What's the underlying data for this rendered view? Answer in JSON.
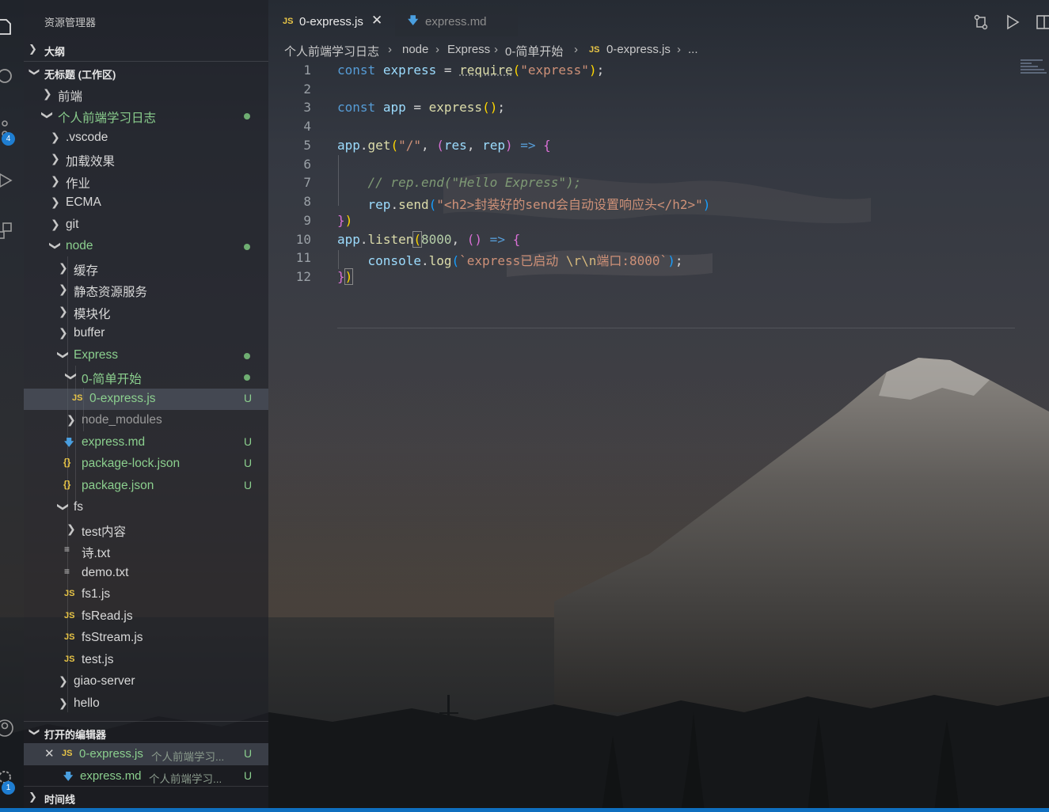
{
  "sidebar": {
    "title": "资源管理器",
    "outline_label": "大纲",
    "workspace_label": "无标题 (工作区)",
    "tree": [
      {
        "label": "前端"
      },
      {
        "label": "个人前端学习日志"
      },
      {
        "label": ".vscode"
      },
      {
        "label": "加载效果"
      },
      {
        "label": "作业"
      },
      {
        "label": "ECMA"
      },
      {
        "label": "git"
      },
      {
        "label": "node"
      },
      {
        "label": "缓存"
      },
      {
        "label": "静态资源服务"
      },
      {
        "label": "模块化"
      },
      {
        "label": "buffer"
      },
      {
        "label": "Express"
      },
      {
        "label": "0-简单开始"
      },
      {
        "label": "0-express.js",
        "status": "U"
      },
      {
        "label": "node_modules"
      },
      {
        "label": "express.md",
        "status": "U"
      },
      {
        "label": "package-lock.json",
        "status": "U"
      },
      {
        "label": "package.json",
        "status": "U"
      },
      {
        "label": "fs"
      },
      {
        "label": "test内容"
      },
      {
        "label": "诗.txt"
      },
      {
        "label": "demo.txt"
      },
      {
        "label": "fs1.js"
      },
      {
        "label": "fsRead.js"
      },
      {
        "label": "fsStream.js"
      },
      {
        "label": "test.js"
      },
      {
        "label": "giao-server"
      },
      {
        "label": "hello"
      }
    ],
    "open_editors_label": "打开的编辑器",
    "open_editors": [
      {
        "name": "0-express.js",
        "path": "个人前端学习...",
        "status": "U"
      },
      {
        "name": "express.md",
        "path": "个人前端学习...",
        "status": "U"
      }
    ],
    "timeline_label": "时间线"
  },
  "activity": {
    "source_control_badge": "4",
    "settings_badge": "1"
  },
  "tabs": [
    {
      "label": "0-express.js",
      "icon": "JS",
      "active": true
    },
    {
      "label": "express.md",
      "icon": "markdown-icon",
      "active": false
    }
  ],
  "breadcrumb": [
    "个人前端学习日志",
    "node",
    "Express",
    "0-简单开始",
    "0-express.js",
    "..."
  ],
  "breadcrumb_icon": "JS",
  "file_icons": {
    "js": "JS",
    "json": "{}"
  },
  "code": {
    "line_numbers": [
      "1",
      "2",
      "3",
      "4",
      "5",
      "6",
      "7",
      "8",
      "9",
      "10",
      "11",
      "12"
    ],
    "l1": {
      "kw": "const",
      "name": "express",
      "op": " = ",
      "fn": "require",
      "open": "(",
      "str": "\"express\"",
      "close": ")",
      "end": ";"
    },
    "l3": {
      "kw": "const",
      "name": "app",
      "op": " = ",
      "fn": "express",
      "parens": "()",
      "end": ";"
    },
    "l5": {
      "obj": "app",
      "dot": ".",
      "fn": "get",
      "open": "(",
      "str": "\"/\"",
      "comma": ", ",
      "popen": "(",
      "p1": "res",
      "sep": ", ",
      "p2": "rep",
      "pclose": ")",
      "arrow": " => ",
      "brace": "{"
    },
    "l7": {
      "comment": "// rep.end(\"Hello Express\");"
    },
    "l8": {
      "obj": "rep",
      "dot": ".",
      "fn": "send",
      "open": "(",
      "str": "\"<h2>封装好的send会自动设置响应头</h2>\"",
      "close": ")"
    },
    "l9": {
      "brace": "}",
      "close": ")"
    },
    "l10": {
      "obj": "app",
      "dot": ".",
      "fn": "listen",
      "open": "(",
      "num": "8000",
      "comma": ", ",
      "parens": "()",
      "arrow": " => ",
      "brace": "{"
    },
    "l11": {
      "obj": "console",
      "dot": ".",
      "fn": "log",
      "open": "(",
      "str1": "`express已启动 ",
      "esc": "\\r\\n",
      "str2": "端口:8000`",
      "close": ")",
      "end": ";"
    },
    "l12": {
      "brace": "}",
      "close": ")"
    }
  }
}
